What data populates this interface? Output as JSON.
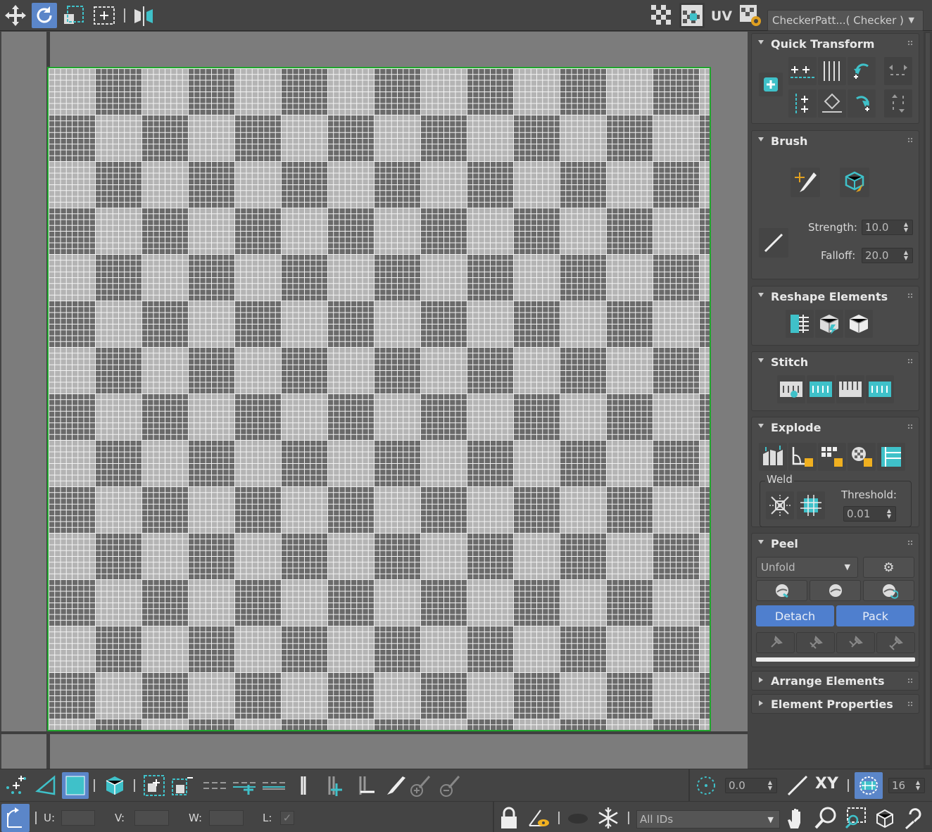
{
  "toolbar": {
    "tools": [
      "move-tool",
      "rotate-tool",
      "scale-tool",
      "freeform-tool",
      "mirror-tool"
    ],
    "uv_label": "UV",
    "map_dropdown": "CheckerPatt...( Checker )"
  },
  "panel": {
    "quick_transform": {
      "title": "Quick Transform"
    },
    "brush": {
      "title": "Brush",
      "strength_label": "Strength:",
      "strength_value": "10.0",
      "falloff_label": "Falloff:",
      "falloff_value": "20.0"
    },
    "reshape": {
      "title": "Reshape Elements"
    },
    "stitch": {
      "title": "Stitch"
    },
    "explode": {
      "title": "Explode",
      "weld_label": "Weld",
      "threshold_label": "Threshold:",
      "threshold_value": "0.01"
    },
    "peel": {
      "title": "Peel",
      "method": "Unfold",
      "detach_label": "Detach",
      "pack_label": "Pack"
    },
    "arrange": {
      "title": "Arrange Elements"
    },
    "properties": {
      "title": "Element Properties"
    }
  },
  "bottom": {
    "angle_value": "0.0",
    "xy_label": "XY",
    "grid_value": "16",
    "u_label": "U:",
    "v_label": "V:",
    "w_label": "W:",
    "l_label": "L:",
    "ids_dropdown": "All IDs"
  },
  "colors": {
    "accent": "#5b86c9",
    "teal": "#3fc1c9",
    "border_green": "#1fa52c",
    "button_blue": "#4f7fce"
  }
}
